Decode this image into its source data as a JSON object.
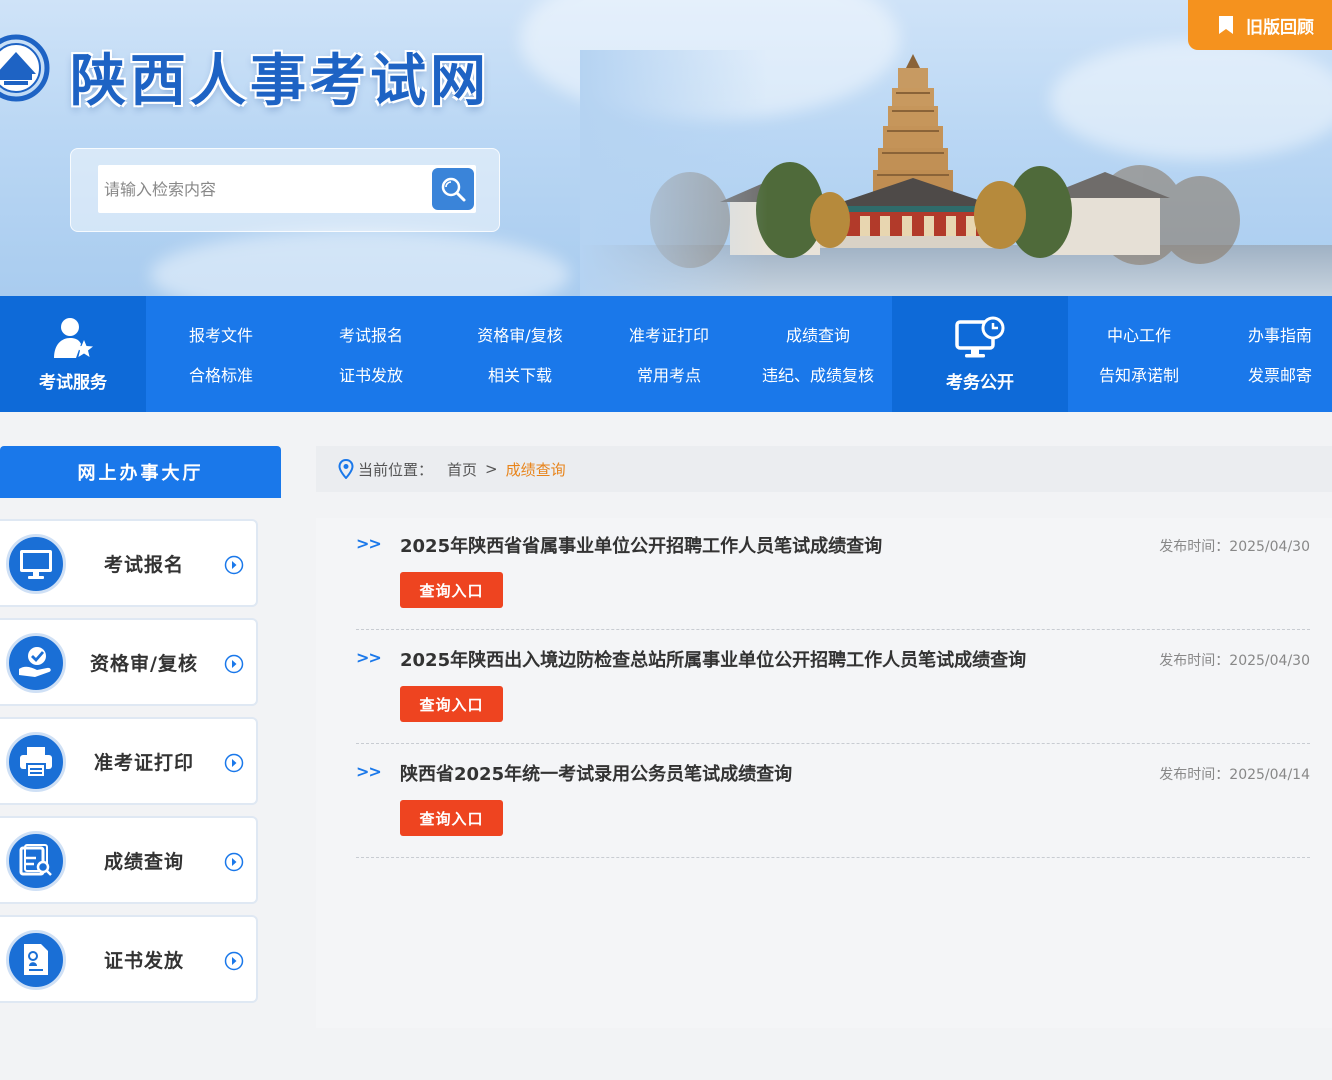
{
  "colors": {
    "brand_blue": "#1a78ea",
    "accent_orange": "#f5921e",
    "query_red": "#ee4420",
    "breadcrumb_current": "#e8841a"
  },
  "header": {
    "site_title": "陕西人事考试网",
    "search_placeholder": "请输入检索内容",
    "old_version_label": "旧版回顾",
    "icons": {
      "logo": "emblem-logo",
      "search": "search-icon",
      "bookmark": "bookmark-icon"
    }
  },
  "nav": {
    "feature_left": {
      "label": "考试服务",
      "icon": "user-star-icon"
    },
    "columns": [
      [
        "报考文件",
        "合格标准"
      ],
      [
        "考试报名",
        "证书发放"
      ],
      [
        "资格审/复核",
        "相关下载"
      ],
      [
        "准考证打印",
        "常用考点"
      ],
      [
        "成绩查询",
        "违纪、成绩复核"
      ]
    ],
    "feature_right": {
      "label": "考务公开",
      "icon": "monitor-clock-icon"
    },
    "columns_right": [
      [
        "中心工作",
        "告知承诺制"
      ],
      [
        "办事指南",
        "发票邮寄"
      ]
    ]
  },
  "sidebar": {
    "title": "网上办事大厅",
    "items": [
      {
        "label": "考试报名",
        "icon": "monitor-icon"
      },
      {
        "label": "资格审/复核",
        "icon": "hand-check-icon"
      },
      {
        "label": "准考证打印",
        "icon": "printer-icon"
      },
      {
        "label": "成绩查询",
        "icon": "document-search-icon"
      },
      {
        "label": "证书发放",
        "icon": "certificate-icon"
      }
    ]
  },
  "breadcrumb": {
    "prefix": "当前位置：",
    "home": "首页",
    "separator": ">",
    "current": "成绩查询"
  },
  "list": {
    "marker": ">>",
    "date_prefix": "发布时间：",
    "button_label": "查询入口",
    "items": [
      {
        "title": "2025年陕西省省属事业单位公开招聘工作人员笔试成绩查询",
        "date": "2025/04/30"
      },
      {
        "title": "2025年陕西出入境边防检查总站所属事业单位公开招聘工作人员笔试成绩查询",
        "date": "2025/04/30"
      },
      {
        "title": "陕西省2025年统一考试录用公务员笔试成绩查询",
        "date": "2025/04/14"
      }
    ]
  }
}
